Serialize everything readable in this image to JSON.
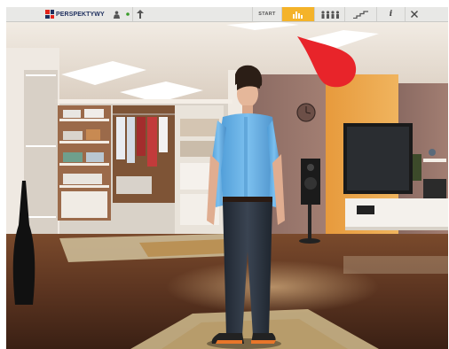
{
  "app": {
    "logo_text": "PERSPEKTYWY"
  },
  "toolbar": {
    "avatar_icon": "person-icon",
    "status_icon": "status-dot-icon",
    "up_icon": "arrow-up-icon",
    "start_label": "START",
    "chart_icon": "bar-chart-icon",
    "group_icon": "people-group-icon",
    "stairs_icon": "stairs-icon",
    "info_icon": "info-icon",
    "info_label": "i",
    "close_icon": "close-icon",
    "active_button": "chart",
    "colors": {
      "accent": "#f4b32a",
      "toolbar_bg": "#e8e8e6",
      "status_dot": "#3a9c2a",
      "pointer": "#e8242a"
    }
  },
  "scene": {
    "description_icons": [
      "clock-icon",
      "tv-icon",
      "speaker-icon",
      "lamp-icon",
      "vase-icon"
    ],
    "character": "avatar-character"
  }
}
